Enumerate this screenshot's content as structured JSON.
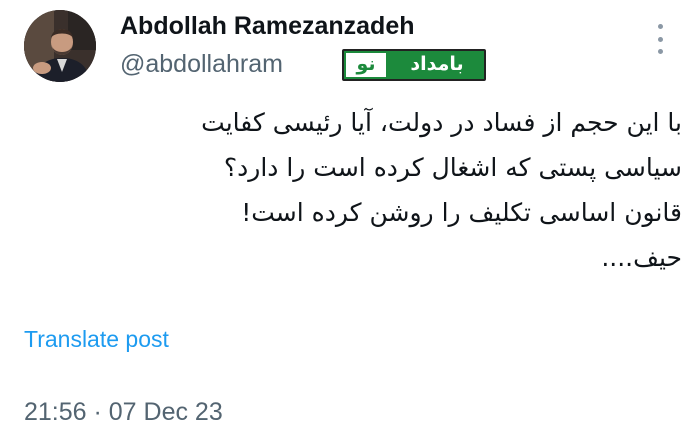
{
  "author": {
    "display_name": "Abdollah Ramezanzadeh",
    "handle": "@abdollahram",
    "avatar_icon": "profile-photo"
  },
  "badge": {
    "word_bamdad": "بامداد",
    "word_no": "نو",
    "bg_color": "#1c8a3c"
  },
  "tweet": {
    "lines": [
      "با این حجم از فساد در دولت، آیا رئیسی کفایت",
      "سیاسی پستی که اشغال کرده است را دارد؟",
      "قانون اساسی تکلیف را روشن کرده است!",
      "حیف...."
    ]
  },
  "actions": {
    "translate_label": "Translate post",
    "more_icon": "more-vertical-icon"
  },
  "meta": {
    "timestamp": "21:56 · 07 Dec 23"
  },
  "colors": {
    "accent": "#1d9bf0",
    "secondary_text": "#536471"
  }
}
